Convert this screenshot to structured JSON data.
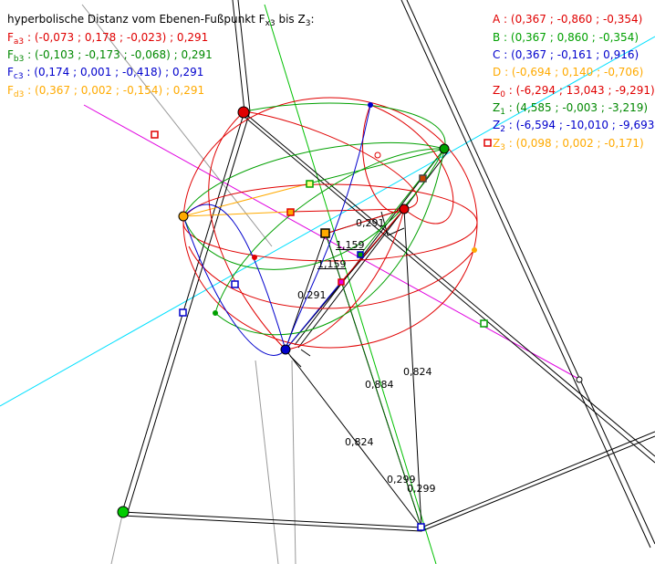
{
  "title": {
    "text": "hyperbolische Distanz vom Ebenen-Fußpunkt F",
    "sub": "x3",
    "tail": " bis Z",
    "sub2": "3",
    "end": ":"
  },
  "distances": [
    {
      "name": "F",
      "sub": "a3",
      "value": " : (-0,073 ; 0,178 ; -0,023) ; 0,291",
      "color": "#e00000"
    },
    {
      "name": "F",
      "sub": "b3",
      "value": " : (-0,103 ; -0,173 ; -0,068) ; 0,291",
      "color": "#008800"
    },
    {
      "name": "F",
      "sub": "c3",
      "value": " : (0,174 ; 0,001 ; -0,418) ; 0,291",
      "color": "#0000cc"
    },
    {
      "name": "F",
      "sub": "d3",
      "value": " : (0,367 ; 0,002 ; -0,154) ; 0,291",
      "color": "#ffaa00"
    }
  ],
  "points": [
    {
      "name": "A",
      "sub": "",
      "value": " : (0,367 ; -0,860 ; -0,354)",
      "color": "#e00000"
    },
    {
      "name": "B",
      "sub": "",
      "value": " : (0,367 ; 0,860 ; -0,354)",
      "color": "#00a000"
    },
    {
      "name": "C",
      "sub": "",
      "value": " : (0,367 ; -0,161 ; 0,916)",
      "color": "#0000cc"
    },
    {
      "name": "D",
      "sub": "",
      "value": " : (-0,694 ; 0,140 ; -0,706)",
      "color": "#ffaa00"
    },
    {
      "name": "Z",
      "sub": "0",
      "value": " : (-6,294 ; 13,043 ; -9,291)",
      "color": "#e00000"
    },
    {
      "name": "Z",
      "sub": "1",
      "value": " : (4,585 ; -0,003 ; -3,219)",
      "color": "#008800"
    },
    {
      "name": "Z",
      "sub": "2",
      "value": " : (-6,594 ; -10,010 ; -9,693)",
      "color": "#0000cc"
    },
    {
      "name": "Z",
      "sub": "3",
      "value": " : (0,098 ; 0,002 ; -0,171)",
      "color": "#ffaa00"
    }
  ],
  "measures": {
    "m1": "0,291",
    "m2": "1,159",
    "m3": "1,159",
    "m4": "0,291",
    "m5": "0,884",
    "m6": "0,824",
    "m7": "0,824",
    "m8": "0,299",
    "m9": "0,299"
  },
  "colors": {
    "red": "#e00000",
    "green": "#00a000",
    "blue": "#0000cc",
    "orange": "#ffaa00",
    "cyan": "#00e0ff",
    "magenta": "#e000e0",
    "gray": "#999999"
  }
}
